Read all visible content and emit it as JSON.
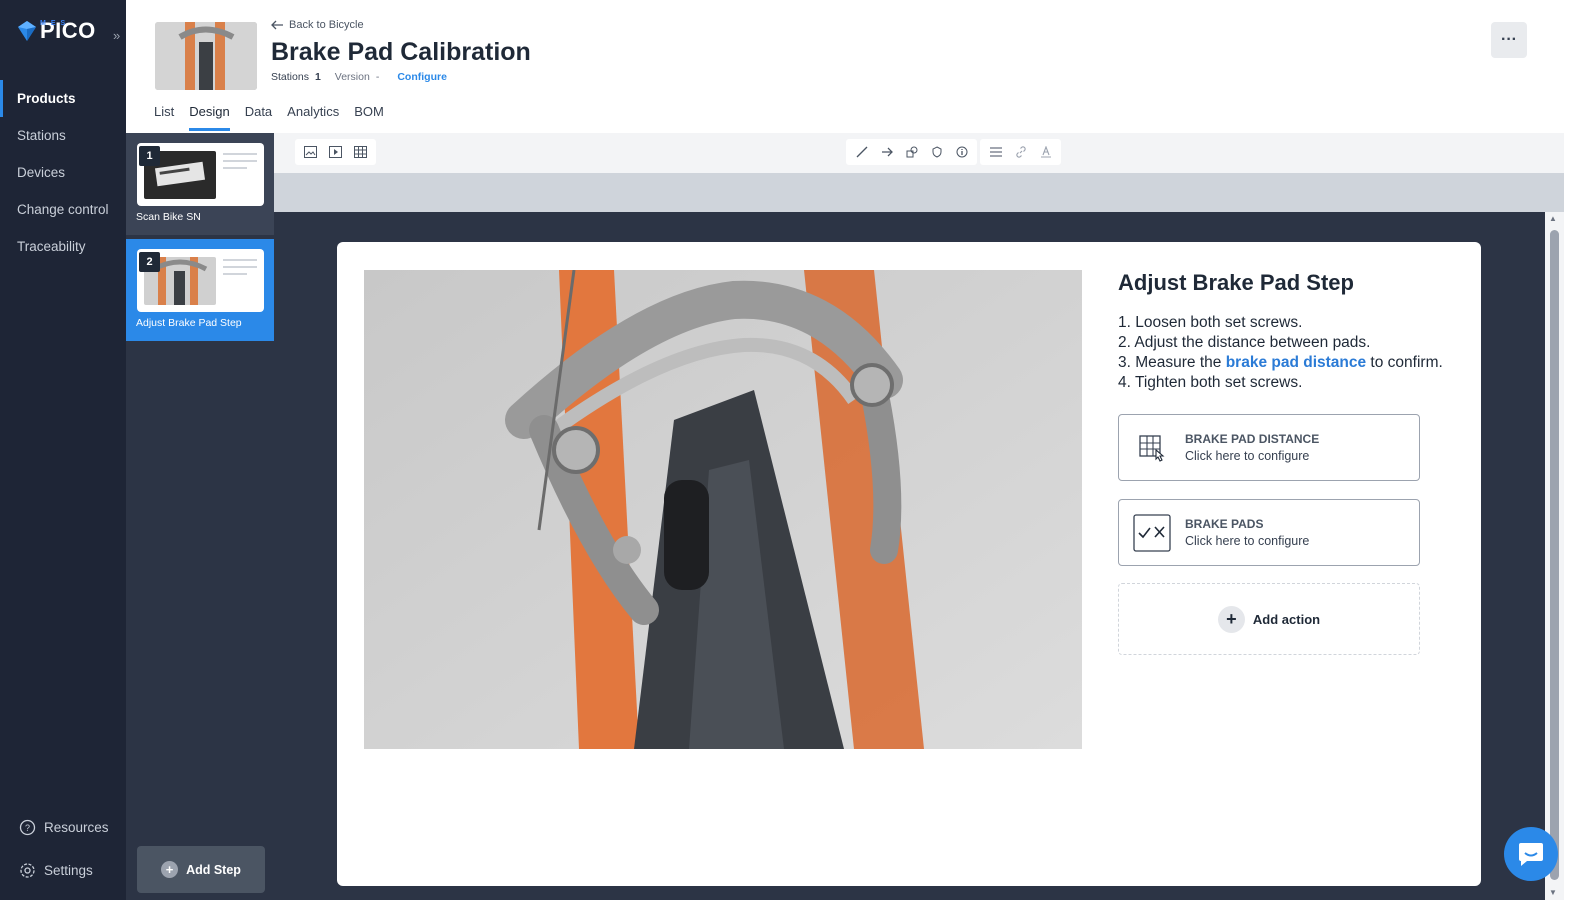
{
  "brand": {
    "name": "PICO",
    "sub": "MES"
  },
  "nav": {
    "items": [
      {
        "label": "Products"
      },
      {
        "label": "Stations"
      },
      {
        "label": "Devices"
      },
      {
        "label": "Change control"
      },
      {
        "label": "Traceability"
      }
    ],
    "resources": "Resources",
    "settings": "Settings"
  },
  "header": {
    "back": "Back to Bicycle",
    "title": "Brake Pad Calibration",
    "stations_label": "Stations",
    "stations_value": "1",
    "version_label": "Version",
    "version_value": "-",
    "configure": "Configure",
    "more": "···"
  },
  "tabs": [
    {
      "label": "List"
    },
    {
      "label": "Design"
    },
    {
      "label": "Data"
    },
    {
      "label": "Analytics"
    },
    {
      "label": "BOM"
    }
  ],
  "steps": [
    {
      "num": "1",
      "label": "Scan Bike SN"
    },
    {
      "num": "2",
      "label": "Adjust Brake Pad Step"
    }
  ],
  "add_step": "Add Step",
  "page": {
    "heading": "Adjust Brake Pad Step",
    "instructions": [
      {
        "prefix": "1. Loosen both set screws.",
        "link": "",
        "suffix": ""
      },
      {
        "prefix": "2. Adjust the distance between pads.",
        "link": "",
        "suffix": ""
      },
      {
        "prefix": "3. Measure the ",
        "link": "brake pad distance",
        "suffix": " to confirm."
      },
      {
        "prefix": "4. Tighten both set screws.",
        "link": "",
        "suffix": ""
      }
    ],
    "actions": [
      {
        "title": "BRAKE PAD DISTANCE",
        "sub": "Click here to configure"
      },
      {
        "title": "BRAKE PADS",
        "sub": "Click here to configure"
      }
    ],
    "add_action": "Add action"
  },
  "colors": {
    "accent": "#2b89e8",
    "nav_bg": "#1e2536",
    "canvas_bg": "#2c3445"
  }
}
